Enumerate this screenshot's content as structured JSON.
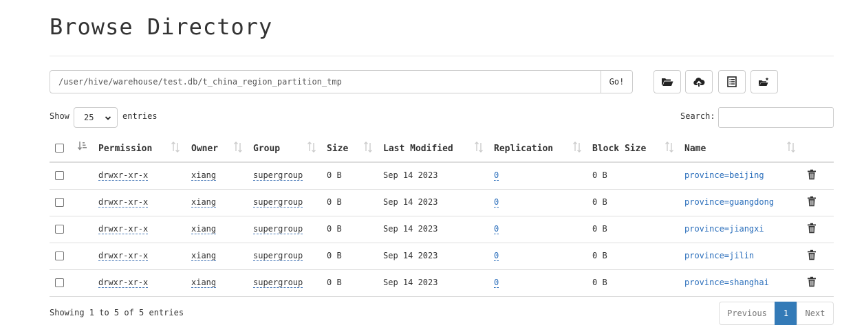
{
  "page_title": "Browse Directory",
  "path_input": {
    "value": "/user/hive/warehouse/test.db/t_china_region_partition_tmp"
  },
  "go_label": "Go!",
  "toolbar": {
    "buttons": [
      {
        "icon": "folder-open-icon"
      },
      {
        "icon": "cloud-upload-icon"
      },
      {
        "icon": "list-alt-icon"
      },
      {
        "icon": "folder-plus-icon"
      }
    ]
  },
  "entries_control": {
    "show": "Show",
    "value": "25",
    "entries": "entries"
  },
  "search": {
    "label": "Search:"
  },
  "table": {
    "columns": [
      "Permission",
      "Owner",
      "Group",
      "Size",
      "Last Modified",
      "Replication",
      "Block Size",
      "Name"
    ],
    "rows": [
      {
        "permission": "drwxr-xr-x",
        "owner": "xiang",
        "group": "supergroup",
        "size": "0 B",
        "modified": "Sep 14 2023",
        "replication": "0",
        "block_size": "0 B",
        "name": "province=beijing"
      },
      {
        "permission": "drwxr-xr-x",
        "owner": "xiang",
        "group": "supergroup",
        "size": "0 B",
        "modified": "Sep 14 2023",
        "replication": "0",
        "block_size": "0 B",
        "name": "province=guangdong"
      },
      {
        "permission": "drwxr-xr-x",
        "owner": "xiang",
        "group": "supergroup",
        "size": "0 B",
        "modified": "Sep 14 2023",
        "replication": "0",
        "block_size": "0 B",
        "name": "province=jiangxi"
      },
      {
        "permission": "drwxr-xr-x",
        "owner": "xiang",
        "group": "supergroup",
        "size": "0 B",
        "modified": "Sep 14 2023",
        "replication": "0",
        "block_size": "0 B",
        "name": "province=jilin"
      },
      {
        "permission": "drwxr-xr-x",
        "owner": "xiang",
        "group": "supergroup",
        "size": "0 B",
        "modified": "Sep 14 2023",
        "replication": "0",
        "block_size": "0 B",
        "name": "province=shanghai"
      }
    ]
  },
  "footer": {
    "info": "Showing 1 to 5 of 5 entries",
    "pagination": {
      "previous": "Previous",
      "current": "1",
      "next": "Next"
    }
  },
  "colors": {
    "link": "#2a6ebb",
    "active_page": "#337ab7",
    "border": "#dddddd"
  }
}
